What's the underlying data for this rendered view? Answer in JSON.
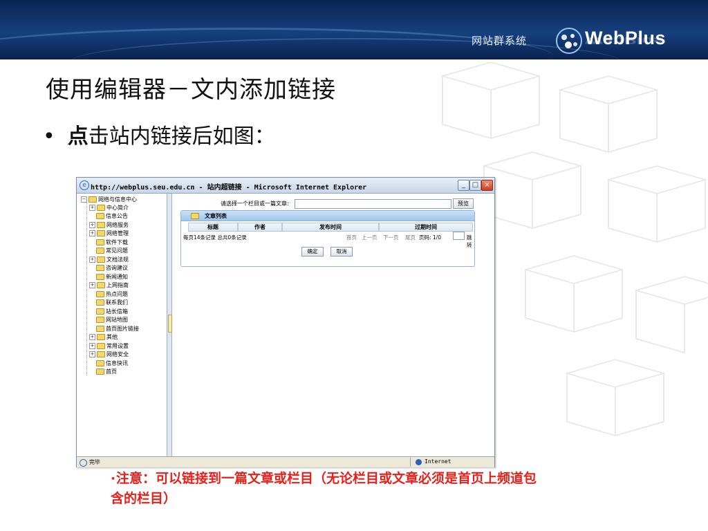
{
  "banner": {
    "system_name": "网站群系统",
    "logo_text": "WebPlus"
  },
  "slide": {
    "title": "使用编辑器－文内添加链接",
    "bullet_bold": "点",
    "bullet_rest": "击站内链接后如图："
  },
  "browser": {
    "title": "http://webplus.seu.edu.cn - 站内超链接 - Microsoft Internet Explorer",
    "status_text": "完毕",
    "zone_text": "Internet",
    "tree": {
      "root": "网络与信息中心",
      "items": [
        "中心简介",
        "信息公告",
        "网络服务",
        "网络管理",
        "软件下载",
        "常见问题",
        "文档法规",
        "咨询建议",
        "新闻通知",
        "上网指南",
        "热点问题",
        "联系我们",
        "站长信箱",
        "网站地图",
        "首页图片链接",
        "其他",
        "常用设置",
        "网络安全",
        "信息快讯",
        "首页"
      ]
    },
    "select_prompt": "请选择一个栏目或一篇文章:",
    "preview_button": "预览",
    "article_panel": {
      "title": "文章列表",
      "columns": [
        "标题",
        "作者",
        "发布时间",
        "过期时间"
      ],
      "records_info": "每页14条记录  总共0条记录",
      "pager": {
        "first": "首页",
        "prev": "上一页",
        "next": "下一页",
        "last": "尾页",
        "page_num": "页码: 1/0",
        "jump": "跳转"
      },
      "ok_button": "确定",
      "cancel_button": "取消"
    }
  },
  "note": {
    "text": "注意：可以链接到一篇文章或栏目（无论栏目或文章必须是首页上频道包含的栏目）"
  },
  "colors": {
    "note_red": "#e8201a",
    "banner_blue": "#16407e",
    "panel_blue": "#9fc6ec"
  }
}
